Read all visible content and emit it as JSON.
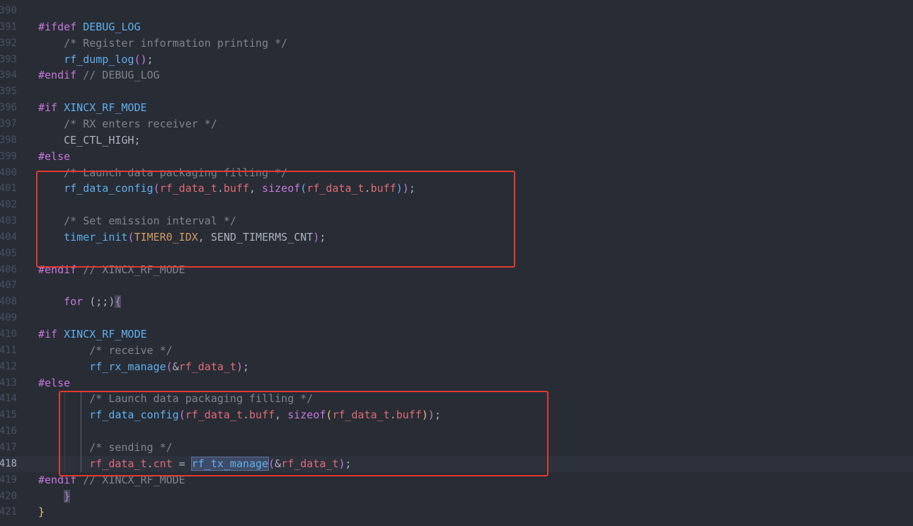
{
  "lines": [
    {
      "num": "390",
      "tokens": []
    },
    {
      "num": "391",
      "tokens": [
        {
          "t": "#ifdef ",
          "c": "kw"
        },
        {
          "t": "DEBUG_LOG",
          "c": "mc"
        }
      ]
    },
    {
      "num": "392",
      "tokens": [
        {
          "t": "    /* Register information printing */",
          "c": "cm"
        }
      ]
    },
    {
      "num": "393",
      "tokens": [
        {
          "t": "    ",
          "c": "pl"
        },
        {
          "t": "rf_dump_log",
          "c": "fn"
        },
        {
          "t": "()",
          "c": "pr1"
        },
        {
          "t": ";",
          "c": "pl"
        }
      ]
    },
    {
      "num": "394",
      "tokens": [
        {
          "t": "#endif",
          "c": "kw"
        },
        {
          "t": " // DEBUG_LOG",
          "c": "cm"
        }
      ]
    },
    {
      "num": "395",
      "tokens": []
    },
    {
      "num": "396",
      "tokens": [
        {
          "t": "#if ",
          "c": "kw"
        },
        {
          "t": "XINCX_RF_MODE",
          "c": "mc"
        }
      ]
    },
    {
      "num": "397",
      "tokens": [
        {
          "t": "    /* RX enters receiver */",
          "c": "cm"
        }
      ]
    },
    {
      "num": "398",
      "tokens": [
        {
          "t": "    CE_CTL_HIGH;",
          "c": "pl"
        }
      ]
    },
    {
      "num": "399",
      "tokens": [
        {
          "t": "#else",
          "c": "kw"
        }
      ]
    },
    {
      "num": "400",
      "tokens": [
        {
          "t": "    /* Launch data packaging filling */",
          "c": "cm"
        }
      ]
    },
    {
      "num": "401",
      "tokens": [
        {
          "t": "    ",
          "c": "pl"
        },
        {
          "t": "rf_data_config",
          "c": "fn"
        },
        {
          "t": "(",
          "c": "pr1"
        },
        {
          "t": "rf_data_t",
          "c": "vr"
        },
        {
          "t": ".",
          "c": "pl"
        },
        {
          "t": "buff",
          "c": "vr"
        },
        {
          "t": ", ",
          "c": "pl"
        },
        {
          "t": "sizeof",
          "c": "kw"
        },
        {
          "t": "(",
          "c": "pr2"
        },
        {
          "t": "rf_data_t",
          "c": "vr"
        },
        {
          "t": ".",
          "c": "pl"
        },
        {
          "t": "buff",
          "c": "vr"
        },
        {
          "t": ")",
          "c": "pr2"
        },
        {
          "t": ")",
          "c": "pr1"
        },
        {
          "t": ";",
          "c": "pl"
        }
      ]
    },
    {
      "num": "402",
      "tokens": []
    },
    {
      "num": "403",
      "tokens": [
        {
          "t": "    /* Set emission interval */",
          "c": "cm"
        }
      ]
    },
    {
      "num": "404",
      "tokens": [
        {
          "t": "    ",
          "c": "pl"
        },
        {
          "t": "timer_init",
          "c": "fn"
        },
        {
          "t": "(",
          "c": "pr1"
        },
        {
          "t": "TIMER0_IDX",
          "c": "cn"
        },
        {
          "t": ", SEND_TIMERMS_CNT",
          "c": "pl"
        },
        {
          "t": ")",
          "c": "pr1"
        },
        {
          "t": ";",
          "c": "pl"
        }
      ]
    },
    {
      "num": "405",
      "tokens": []
    },
    {
      "num": "406",
      "tokens": [
        {
          "t": "#endif",
          "c": "kw"
        },
        {
          "t": " // XINCX_RF_MODE",
          "c": "cm"
        }
      ]
    },
    {
      "num": "407",
      "tokens": []
    },
    {
      "num": "408",
      "tokens": [
        {
          "t": "    ",
          "c": "pl"
        },
        {
          "t": "for",
          "c": "kw"
        },
        {
          "t": " (;;)",
          "c": "pl"
        },
        {
          "t": "{",
          "c": "brace-match"
        }
      ]
    },
    {
      "num": "409",
      "tokens": []
    },
    {
      "num": "410",
      "tokens": [
        {
          "t": "#if ",
          "c": "kw"
        },
        {
          "t": "XINCX_RF_MODE",
          "c": "mc"
        }
      ]
    },
    {
      "num": "411",
      "tokens": [
        {
          "t": "        /* receive */",
          "c": "cm"
        }
      ]
    },
    {
      "num": "412",
      "tokens": [
        {
          "t": "        ",
          "c": "pl"
        },
        {
          "t": "rf_rx_manage",
          "c": "fn"
        },
        {
          "t": "(",
          "c": "pr1"
        },
        {
          "t": "&",
          "c": "pl"
        },
        {
          "t": "rf_data_t",
          "c": "vr"
        },
        {
          "t": ")",
          "c": "pr1"
        },
        {
          "t": ";",
          "c": "pl"
        }
      ]
    },
    {
      "num": "413",
      "tokens": [
        {
          "t": "#else",
          "c": "kw"
        }
      ]
    },
    {
      "num": "414",
      "tokens": [
        {
          "t": "        /* Launch data packaging filling */",
          "c": "cm"
        }
      ]
    },
    {
      "num": "415",
      "tokens": [
        {
          "t": "        ",
          "c": "pl"
        },
        {
          "t": "rf_data_config",
          "c": "fn"
        },
        {
          "t": "(",
          "c": "pr1"
        },
        {
          "t": "rf_data_t",
          "c": "vr"
        },
        {
          "t": ".",
          "c": "pl"
        },
        {
          "t": "buff",
          "c": "vr"
        },
        {
          "t": ", ",
          "c": "pl"
        },
        {
          "t": "sizeof",
          "c": "kw"
        },
        {
          "t": "(",
          "c": "pr3"
        },
        {
          "t": "rf_data_t",
          "c": "vr"
        },
        {
          "t": ".",
          "c": "pl"
        },
        {
          "t": "buff",
          "c": "vr"
        },
        {
          "t": ")",
          "c": "pr3"
        },
        {
          "t": ")",
          "c": "pr1"
        },
        {
          "t": ";",
          "c": "pl"
        }
      ]
    },
    {
      "num": "416",
      "tokens": []
    },
    {
      "num": "417",
      "tokens": [
        {
          "t": "        /* sending */",
          "c": "cm"
        }
      ]
    },
    {
      "num": "418",
      "tokens": [
        {
          "t": "        ",
          "c": "pl"
        },
        {
          "t": "rf_data_t",
          "c": "vr"
        },
        {
          "t": ".",
          "c": "pl"
        },
        {
          "t": "cnt",
          "c": "vr"
        },
        {
          "t": " = ",
          "c": "pl"
        },
        {
          "t": "rf_tx_manage",
          "c": "fn sel-word"
        },
        {
          "t": "(",
          "c": "pr1"
        },
        {
          "t": "&",
          "c": "pl"
        },
        {
          "t": "rf_data_t",
          "c": "vr"
        },
        {
          "t": ")",
          "c": "pr1"
        },
        {
          "t": ";",
          "c": "pl"
        }
      ],
      "current": true
    },
    {
      "num": "419",
      "tokens": [
        {
          "t": "#endif",
          "c": "kw"
        },
        {
          "t": " // XINCX_RF_MODE",
          "c": "cm"
        }
      ]
    },
    {
      "num": "420",
      "tokens": [
        {
          "t": "    ",
          "c": "pl"
        },
        {
          "t": "}",
          "c": "brace-match"
        }
      ]
    },
    {
      "num": "421",
      "tokens": [
        {
          "t": "}",
          "c": "brace-y"
        }
      ]
    }
  ],
  "colors": {
    "background": "#282c34",
    "keyword": "#c678dd",
    "function": "#61afef",
    "comment": "#7f848e",
    "variable": "#e06c75",
    "constant": "#d19a66",
    "annotation_box": "#e03a2f"
  }
}
